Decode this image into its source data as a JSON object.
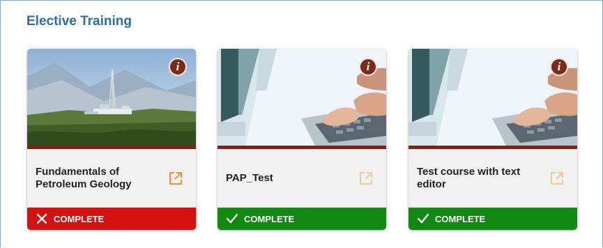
{
  "section": {
    "title": "Elective Training"
  },
  "colors": {
    "title_blue": "#2e6ea6",
    "accent_bar": "#8a1c10",
    "info_button": "#7d2a17",
    "launch_active": "#e8923a",
    "launch_muted": "#f2c89f",
    "status_fail": "#d51010",
    "status_pass": "#128a12"
  },
  "courses": [
    {
      "title": "Fundamentals of Petroleum Geology",
      "thumbnail": "oil-rig-landscape",
      "info_icon": "info-icon",
      "launch_icon": "external-link-icon",
      "launch_state": "active",
      "status_icon": "x-icon",
      "status_label": "COMPLETE"
    },
    {
      "title": "PAP_Test",
      "thumbnail": "hands-typing-keyboard",
      "info_icon": "info-icon",
      "launch_icon": "external-link-icon",
      "launch_state": "muted",
      "status_icon": "check-icon",
      "status_label": "COMPLETE"
    },
    {
      "title": "Test course with text editor",
      "thumbnail": "hands-typing-keyboard",
      "info_icon": "info-icon",
      "launch_icon": "external-link-icon",
      "launch_state": "muted",
      "status_icon": "check-icon",
      "status_label": "COMPLETE"
    }
  ],
  "info_glyph": "i"
}
